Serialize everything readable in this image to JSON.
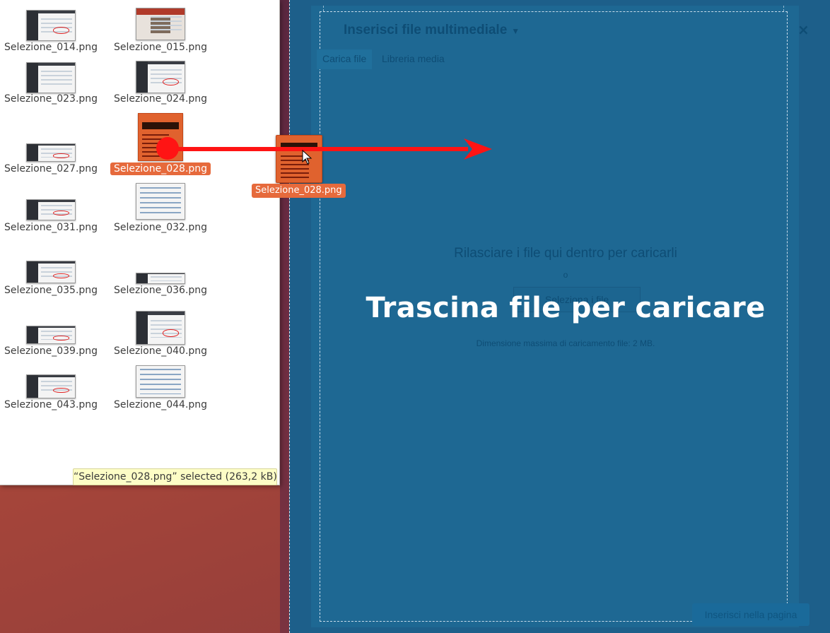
{
  "file_manager": {
    "files": [
      {
        "name": "Selezione_014.png",
        "style": "wp",
        "mark": true
      },
      {
        "name": "Selezione_015.png",
        "style": "photo"
      },
      {
        "name": "Selezione_023.png",
        "style": "wp"
      },
      {
        "name": "Selezione_024.png",
        "style": "wp",
        "mark": true
      },
      {
        "name": "Selezione_027.png",
        "style": "wp",
        "mark": true
      },
      {
        "name": "Selezione_028.png",
        "style": "selected",
        "selected": true
      },
      {
        "name": "Selezione_031.png",
        "style": "wp",
        "mark": true
      },
      {
        "name": "Selezione_032.png",
        "style": "doc"
      },
      {
        "name": "Selezione_035.png",
        "style": "wp",
        "mark": true
      },
      {
        "name": "Selezione_036.png",
        "style": "wp"
      },
      {
        "name": "Selezione_039.png",
        "style": "wp",
        "mark": true
      },
      {
        "name": "Selezione_040.png",
        "style": "wp",
        "mark": true
      },
      {
        "name": "Selezione_043.png",
        "style": "wp",
        "mark": true
      },
      {
        "name": "Selezione_044.png",
        "style": "doc"
      }
    ],
    "status": "“Selezione_028.png” selected  (263,2 kB)"
  },
  "drag_ghost": {
    "label": "Selezione_028.png"
  },
  "media_dialog": {
    "title": "Inserisci file multimediale",
    "caret": "▼",
    "close": "×",
    "tabs": [
      {
        "label": "Carica file",
        "active": true
      },
      {
        "label": "Libreria media",
        "active": false
      }
    ],
    "drop_instructions": "Rilasciare i file qui dentro per caricarli",
    "or_text": "o",
    "select_button": "Seleziona i file",
    "drag_message": "Trascina file per caricare",
    "max_size": "Dimensione massima di caricamento file: 2 MB.",
    "insert_button": "Inserisci nella pagina"
  },
  "colors": {
    "selection": "#e66a3c",
    "dialog_overlay": "#1e6893",
    "arrow": "#ff1414"
  }
}
